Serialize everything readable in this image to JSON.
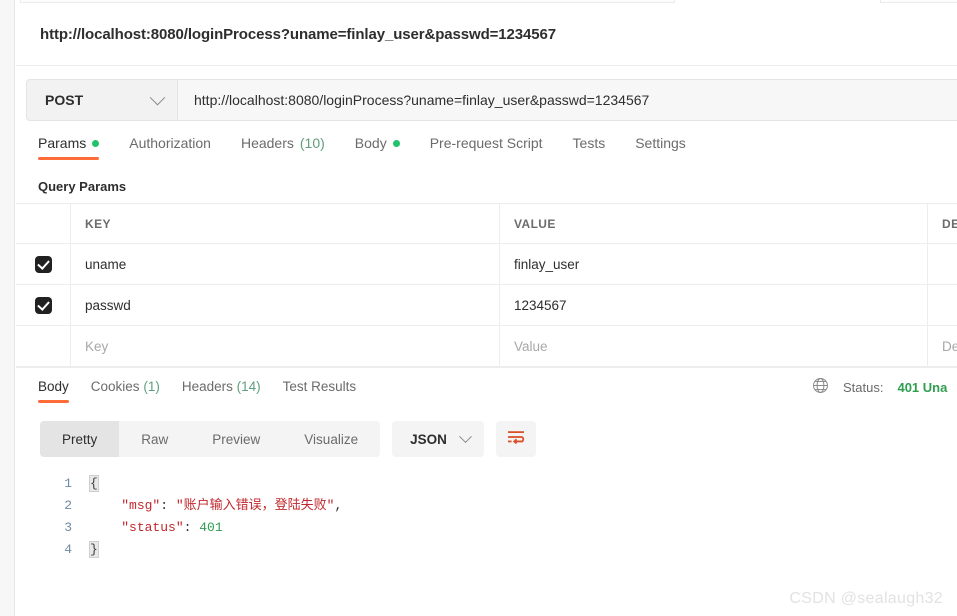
{
  "request": {
    "title": "http://localhost:8080/loginProcess?uname=finlay_user&passwd=1234567",
    "method": "POST",
    "url": "http://localhost:8080/loginProcess?uname=finlay_user&passwd=1234567",
    "tabs": [
      {
        "label": "Params",
        "dot": true,
        "active": true
      },
      {
        "label": "Authorization",
        "dot": false,
        "active": false
      },
      {
        "label": "Headers",
        "count": "(10)",
        "dot": false,
        "active": false
      },
      {
        "label": "Body",
        "dot": true,
        "active": false
      },
      {
        "label": "Pre-request Script",
        "dot": false,
        "active": false
      },
      {
        "label": "Tests",
        "dot": false,
        "active": false
      },
      {
        "label": "Settings",
        "dot": false,
        "active": false
      }
    ],
    "section_label": "Query Params",
    "table": {
      "headers": {
        "key": "KEY",
        "value": "VALUE",
        "description": "DE"
      },
      "rows": [
        {
          "checked": true,
          "key": "uname",
          "value": "finlay_user",
          "description": ""
        },
        {
          "checked": true,
          "key": "passwd",
          "value": "1234567",
          "description": ""
        }
      ],
      "placeholder_row": {
        "key": "Key",
        "value": "Value",
        "description": "De"
      }
    }
  },
  "response": {
    "tabs": [
      {
        "label": "Body",
        "active": true
      },
      {
        "label": "Cookies",
        "count": "(1)",
        "active": false
      },
      {
        "label": "Headers",
        "count": "(14)",
        "active": false
      },
      {
        "label": "Test Results",
        "active": false
      }
    ],
    "status_label": "Status:",
    "status_value": "401 Una",
    "view_modes": [
      {
        "label": "Pretty",
        "active": true
      },
      {
        "label": "Raw",
        "active": false
      },
      {
        "label": "Preview",
        "active": false
      },
      {
        "label": "Visualize",
        "active": false
      }
    ],
    "format": "JSON",
    "body_lines": [
      {
        "n": "1",
        "segments": [
          {
            "t": "{",
            "c": "brace"
          }
        ]
      },
      {
        "n": "2",
        "segments": [
          {
            "t": "    ",
            "c": "k-pun"
          },
          {
            "t": "\"msg\"",
            "c": "k-key"
          },
          {
            "t": ": ",
            "c": "k-pun"
          },
          {
            "t": "\"账户输入错误，登陆失败\"",
            "c": "k-str"
          },
          {
            "t": ",",
            "c": "k-pun"
          }
        ]
      },
      {
        "n": "3",
        "segments": [
          {
            "t": "    ",
            "c": "k-pun"
          },
          {
            "t": "\"status\"",
            "c": "k-key"
          },
          {
            "t": ": ",
            "c": "k-pun"
          },
          {
            "t": "401",
            "c": "k-num"
          }
        ]
      },
      {
        "n": "4",
        "segments": [
          {
            "t": "}",
            "c": "brace"
          }
        ]
      }
    ]
  },
  "watermark": "CSDN @sealaugh32",
  "colors": {
    "accent": "#ff6c37",
    "green_dot": "#1fc36a",
    "status_green": "#2e9e4f",
    "string_red": "#c1282d"
  },
  "icons": {
    "method_chevron": "chevron-down-icon",
    "format_chevron": "chevron-down-icon",
    "wrap": "word-wrap-icon",
    "globe": "globe-icon",
    "checkbox": "checkbox-checked-icon"
  }
}
